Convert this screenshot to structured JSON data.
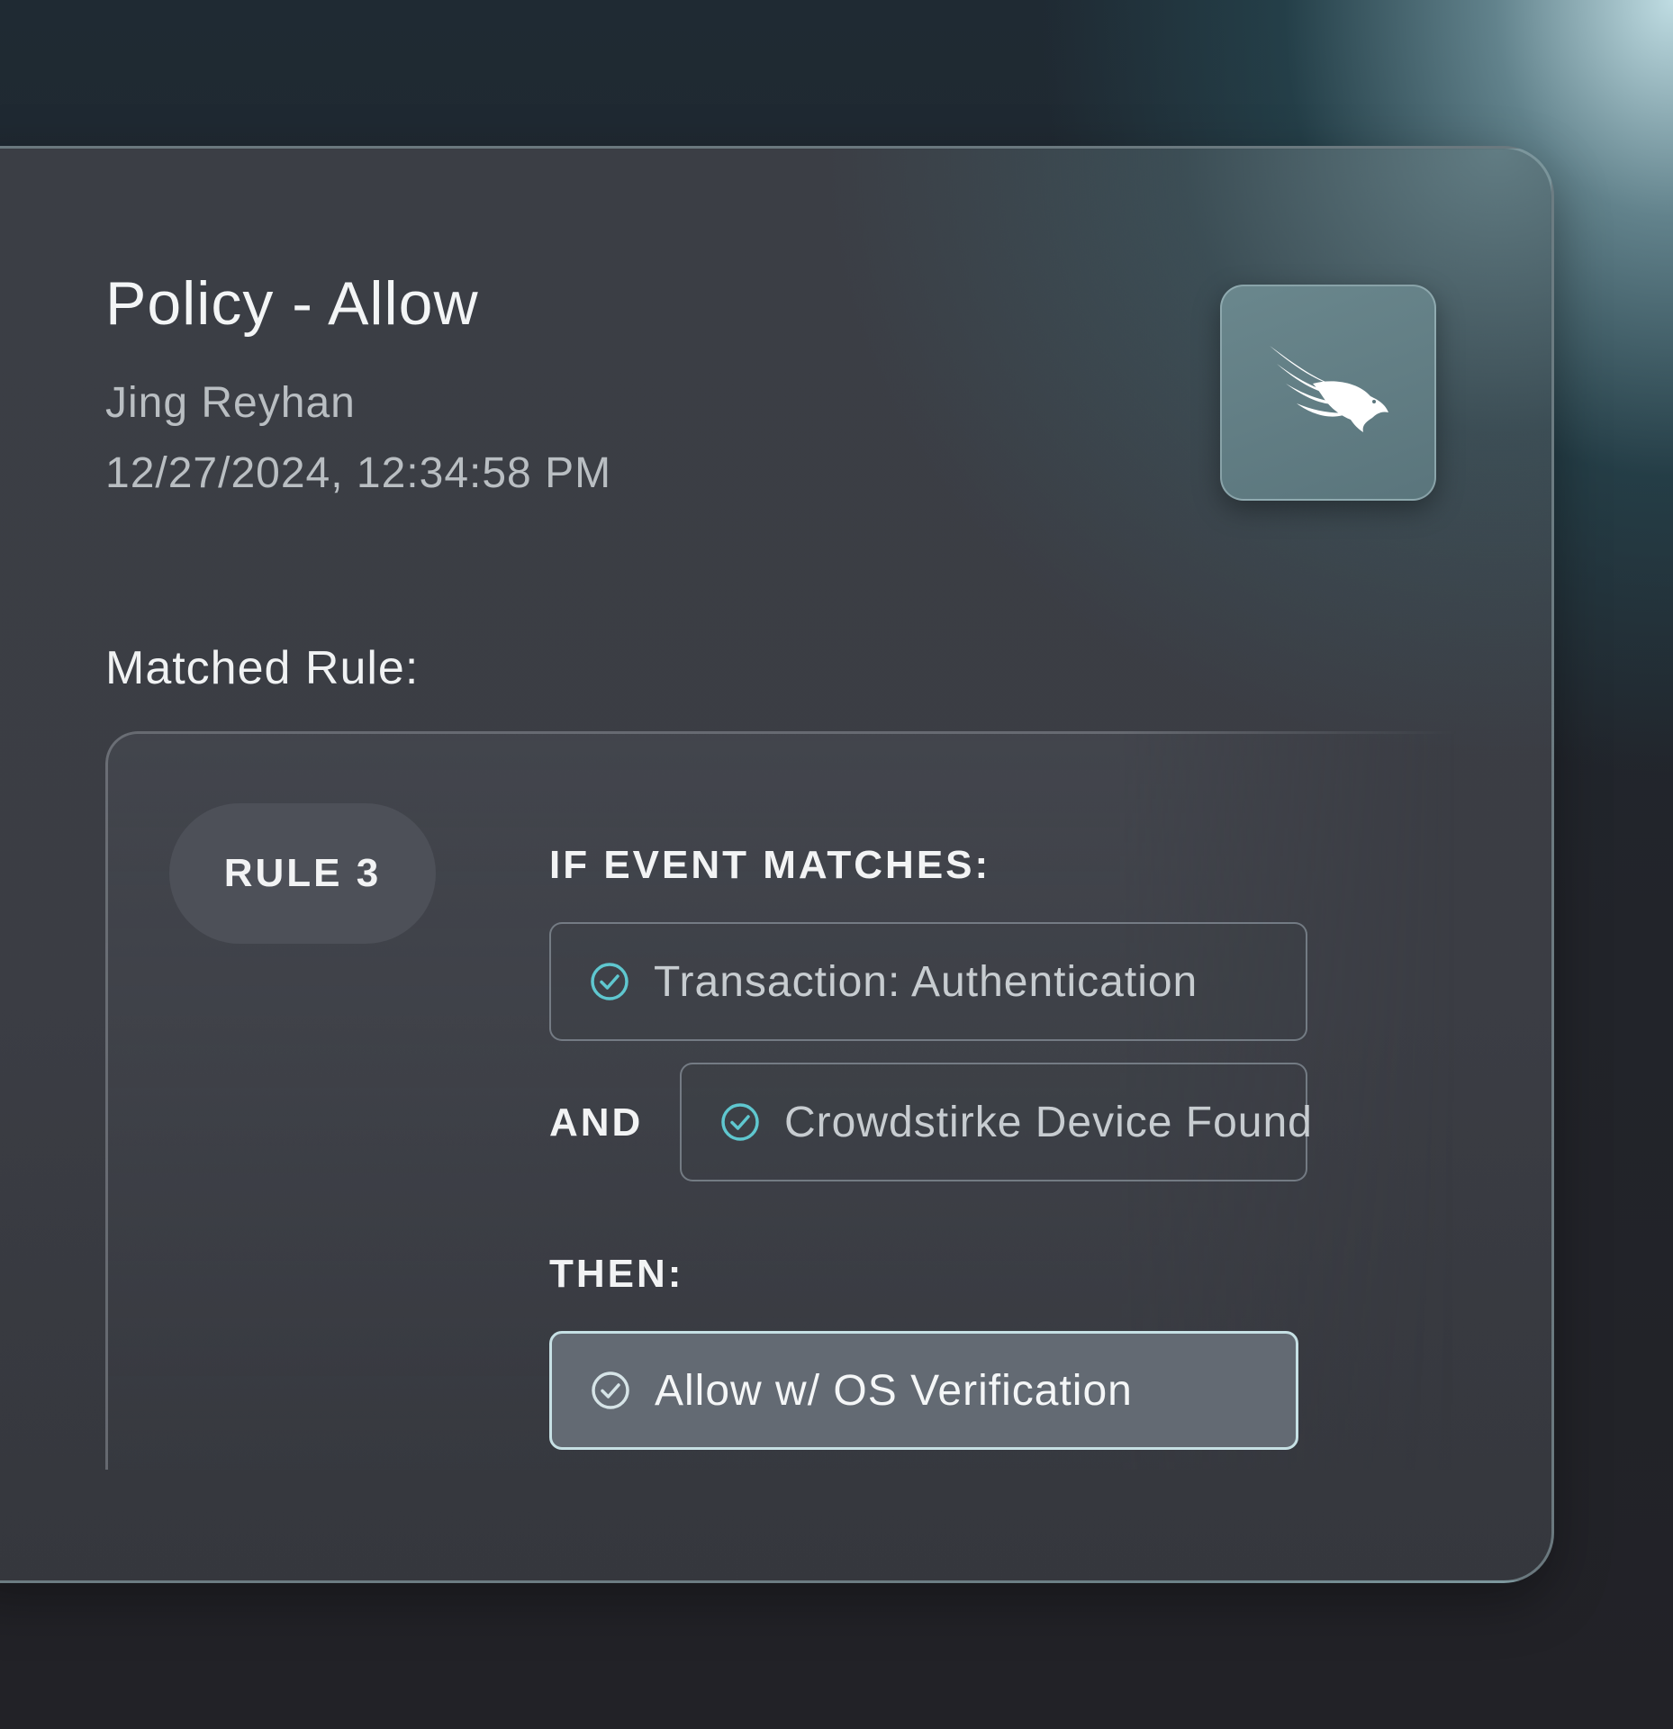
{
  "policy": {
    "title": "Policy - Allow",
    "user": "Jing Reyhan",
    "timestamp": "12/27/2024, 12:34:58 PM",
    "logo_icon": "falcon-icon"
  },
  "matched_rule": {
    "label": "Matched Rule:",
    "rule_name": "RULE 3",
    "if_label": "IF EVENT MATCHES:",
    "conditions": [
      {
        "text": "Transaction: Authentication",
        "icon": "check-circle-icon"
      },
      {
        "text": "Crowdstirke Device Found",
        "icon": "check-circle-icon"
      }
    ],
    "and_label": "AND",
    "then_label": "THEN:",
    "action": {
      "text": "Allow w/ OS Verification",
      "icon": "check-circle-icon"
    }
  },
  "colors": {
    "accent_check": "#5fc7cf",
    "action_border": "#c6e0e4",
    "card_bg": "#3b3e45"
  }
}
